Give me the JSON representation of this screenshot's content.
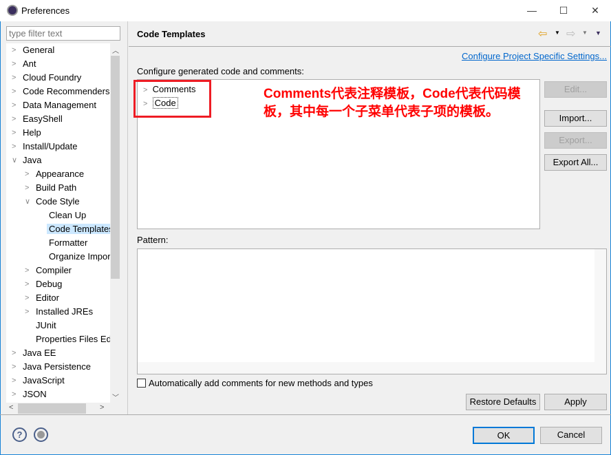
{
  "window": {
    "title": "Preferences",
    "minimize": "—",
    "maximize": "☐",
    "close": "✕"
  },
  "filter": {
    "placeholder": "type filter text"
  },
  "tree": [
    {
      "label": "General",
      "level": 0,
      "arrow": "closed"
    },
    {
      "label": "Ant",
      "level": 0,
      "arrow": "closed"
    },
    {
      "label": "Cloud Foundry",
      "level": 0,
      "arrow": "closed"
    },
    {
      "label": "Code Recommenders",
      "level": 0,
      "arrow": "closed"
    },
    {
      "label": "Data Management",
      "level": 0,
      "arrow": "closed"
    },
    {
      "label": "EasyShell",
      "level": 0,
      "arrow": "closed"
    },
    {
      "label": "Help",
      "level": 0,
      "arrow": "closed"
    },
    {
      "label": "Install/Update",
      "level": 0,
      "arrow": "closed"
    },
    {
      "label": "Java",
      "level": 0,
      "arrow": "open"
    },
    {
      "label": "Appearance",
      "level": 1,
      "arrow": "closed"
    },
    {
      "label": "Build Path",
      "level": 1,
      "arrow": "closed"
    },
    {
      "label": "Code Style",
      "level": 1,
      "arrow": "open"
    },
    {
      "label": "Clean Up",
      "level": 2,
      "arrow": "none"
    },
    {
      "label": "Code Templates",
      "level": 2,
      "arrow": "none",
      "selected": true
    },
    {
      "label": "Formatter",
      "level": 2,
      "arrow": "none"
    },
    {
      "label": "Organize Imports",
      "level": 2,
      "arrow": "none"
    },
    {
      "label": "Compiler",
      "level": 1,
      "arrow": "closed"
    },
    {
      "label": "Debug",
      "level": 1,
      "arrow": "closed"
    },
    {
      "label": "Editor",
      "level": 1,
      "arrow": "closed"
    },
    {
      "label": "Installed JREs",
      "level": 1,
      "arrow": "closed"
    },
    {
      "label": "JUnit",
      "level": 1,
      "arrow": "none"
    },
    {
      "label": "Properties Files Editor",
      "level": 1,
      "arrow": "none"
    },
    {
      "label": "Java EE",
      "level": 0,
      "arrow": "closed"
    },
    {
      "label": "Java Persistence",
      "level": 0,
      "arrow": "closed"
    },
    {
      "label": "JavaScript",
      "level": 0,
      "arrow": "closed"
    },
    {
      "label": "JSON",
      "level": 0,
      "arrow": "closed"
    }
  ],
  "page": {
    "title": "Code Templates",
    "configure_link": "Configure Project Specific Settings...",
    "description": "Configure generated code and comments:",
    "templates": [
      "Comments",
      "Code"
    ],
    "annotation": "Comments代表注释模板，Code代表代码模板，其中每一个子菜单代表子项的模板。",
    "buttons": {
      "edit": "Edit...",
      "import": "Import...",
      "export": "Export...",
      "export_all": "Export All..."
    },
    "pattern_label": "Pattern:",
    "auto_comments": "Automatically add comments for new methods and types",
    "restore_defaults": "Restore Defaults",
    "apply": "Apply"
  },
  "footer": {
    "ok": "OK",
    "cancel": "Cancel"
  },
  "colors": {
    "annotation": "#ff0000",
    "link": "#0066cc",
    "selection": "#cce8ff"
  }
}
